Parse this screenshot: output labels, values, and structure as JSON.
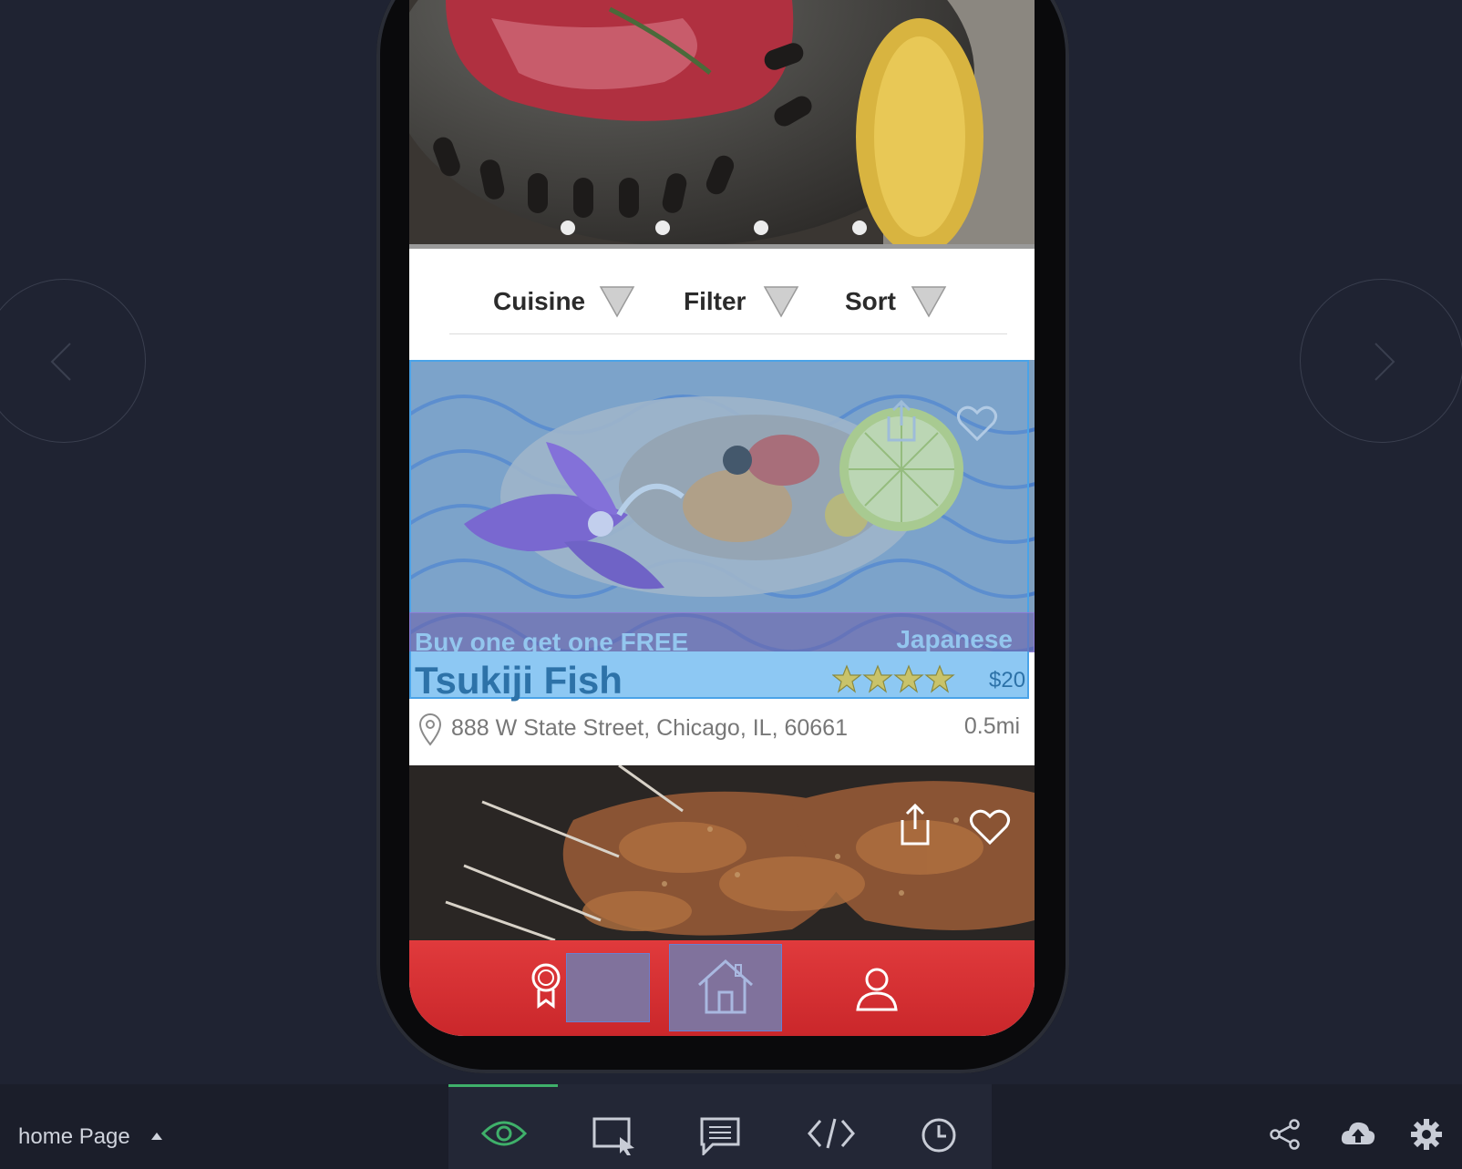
{
  "page": {
    "name": "home Page"
  },
  "filters": {
    "cuisine": "Cuisine",
    "filter": "Filter",
    "sort": "Sort"
  },
  "restaurant": {
    "promo": "Buy one get one FREE",
    "cuisine": "Japanese",
    "name": "Tsukiji Fish",
    "price": "$20",
    "address": "888 W State Street, Chicago, IL, 60661",
    "distance": "0.5mi",
    "rating": 4
  },
  "carousel": {
    "slides": 4
  },
  "tabbar": {
    "tabs": [
      "awards-icon",
      "home-icon",
      "profile-icon"
    ]
  },
  "toolbar": {
    "modes": [
      "eye-icon",
      "select-icon",
      "comment-icon",
      "code-icon",
      "history-icon"
    ],
    "actions": [
      "share-icon",
      "cloud-upload-icon",
      "settings-icon"
    ]
  },
  "colors": {
    "accent": "#3fb06a",
    "brand_red": "#d8302f",
    "selection": "#4aa3e8"
  }
}
